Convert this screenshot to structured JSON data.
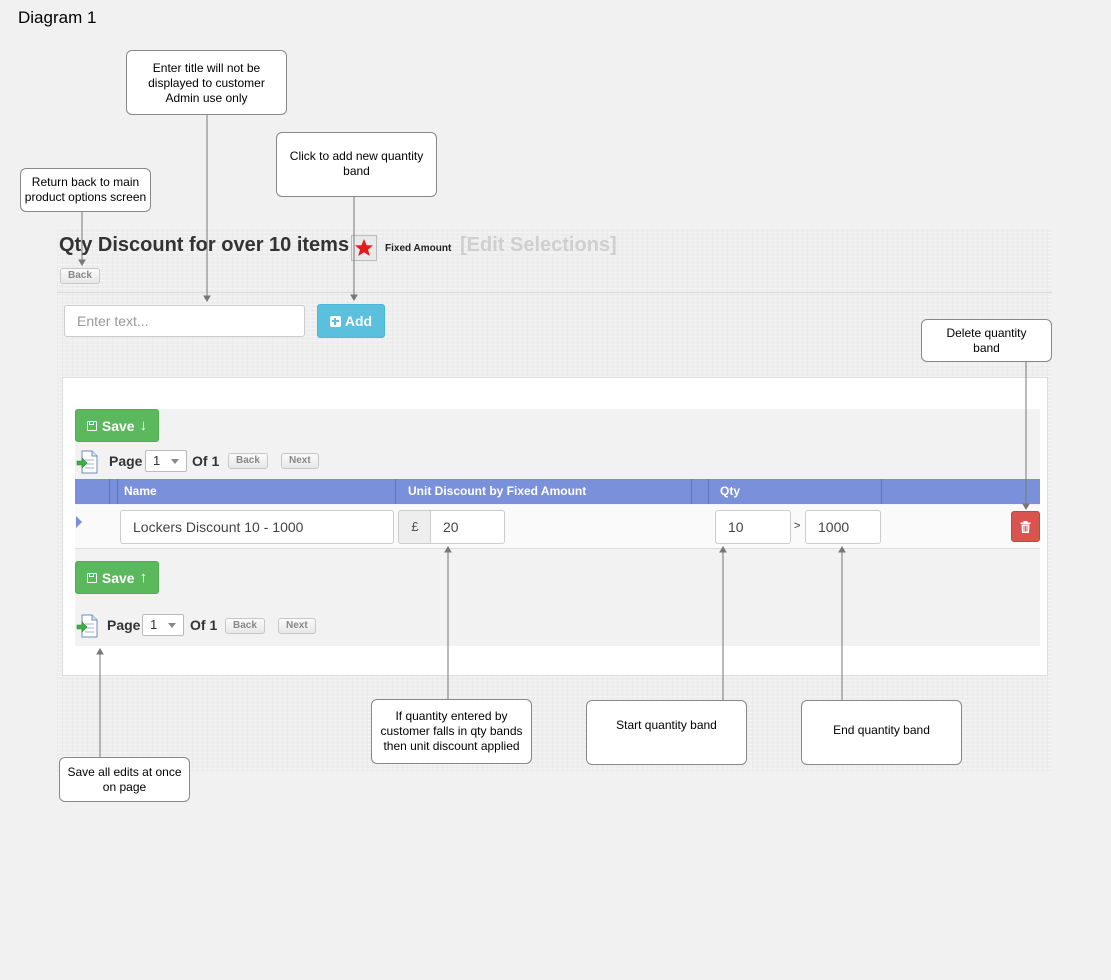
{
  "diagram_title": "Diagram 1",
  "header": {
    "title": "Qty Discount for over 10 items",
    "badge_label": "Fixed Amount",
    "edit_selections": "[Edit Selections]",
    "back": "Back"
  },
  "add_form": {
    "placeholder": "Enter text...",
    "add_label": "Add"
  },
  "pager": {
    "save_label": "Save",
    "page_label": "Page",
    "page_value": "1",
    "of_label": "Of 1",
    "back": "Back",
    "next": "Next"
  },
  "table": {
    "columns": [
      "Name",
      "Unit Discount by Fixed Amount",
      "Qty"
    ],
    "rows": [
      {
        "name": "Lockers Discount 10 - 1000",
        "currency": "£",
        "discount": "20",
        "qty_from": "10",
        "separator": ">",
        "qty_to": "1000"
      }
    ]
  },
  "callouts": {
    "title_note": [
      "Enter title will not be",
      "displayed to customer",
      "Admin use only"
    ],
    "add_note": [
      "Click to add new quantity",
      "band"
    ],
    "back_note": [
      "Return back to main",
      "product options screen"
    ],
    "delete_note": [
      "Delete quantity",
      "band"
    ],
    "discount_note": [
      "If quantity entered by",
      "customer falls in qty bands",
      "then unit discount applied"
    ],
    "start_note": [
      "Start quantity band"
    ],
    "end_note": [
      "End quantity band"
    ],
    "save_note": [
      "Save all edits at once",
      "on page"
    ]
  },
  "colors": {
    "header_blue": "#7b90db",
    "save_green": "#5cb85c",
    "add_cyan": "#5bc0de",
    "delete_red": "#d9534f"
  }
}
